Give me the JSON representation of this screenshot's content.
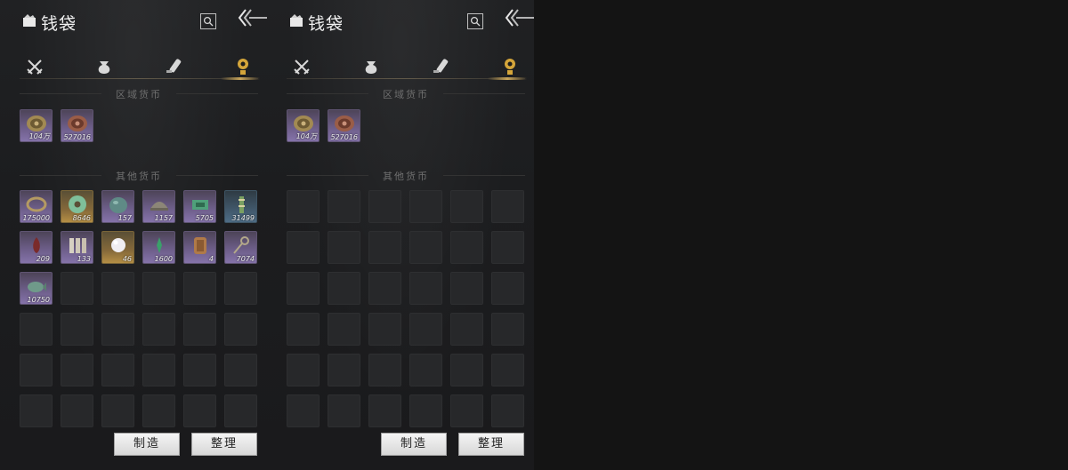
{
  "panels": [
    {
      "title": "钱袋",
      "title_icon": "wallet-icon",
      "search_icon": "search-icon",
      "back_icon": "back-arrow-icon",
      "tabs": [
        {
          "icon": "crossed-swords-icon",
          "active": false
        },
        {
          "icon": "pouch-icon",
          "active": false
        },
        {
          "icon": "scroll-icon",
          "active": false
        },
        {
          "icon": "coin-marker-icon",
          "active": true
        }
      ],
      "regional_header": "区域货币",
      "regional_items": [
        {
          "icon": "gold-disc-coin-icon",
          "count": "104万"
        },
        {
          "icon": "bronze-disc-coin-icon",
          "count": "527016"
        }
      ],
      "other_header": "其他货币",
      "other_items": [
        {
          "icon": "bracelet-icon",
          "count": "175000",
          "rarity": "purple"
        },
        {
          "icon": "jade-ring-icon",
          "count": "8646",
          "rarity": "gold"
        },
        {
          "icon": "green-pebble-icon",
          "count": "157",
          "rarity": "purple"
        },
        {
          "icon": "ingot-icon",
          "count": "1157",
          "rarity": "purple"
        },
        {
          "icon": "green-note-icon",
          "count": "5705",
          "rarity": "purple"
        },
        {
          "icon": "green-token-icon",
          "count": "31499",
          "rarity": "teal"
        },
        {
          "icon": "red-flame-icon",
          "count": "209",
          "rarity": "purple"
        },
        {
          "icon": "bone-slips-icon",
          "count": "133",
          "rarity": "purple"
        },
        {
          "icon": "pearl-icon",
          "count": "46",
          "rarity": "gold"
        },
        {
          "icon": "green-spark-icon",
          "count": "1600",
          "rarity": "purple"
        },
        {
          "icon": "carved-tablet-icon",
          "count": "4",
          "rarity": "purple"
        },
        {
          "icon": "key-icon",
          "count": "7074",
          "rarity": "purple"
        },
        {
          "icon": "jade-carp-icon",
          "count": "10750",
          "rarity": "purple"
        }
      ],
      "buttons": {
        "craft": "制造",
        "sort": "整理"
      }
    },
    {
      "title": "钱袋",
      "title_icon": "wallet-icon",
      "search_icon": "search-icon",
      "back_icon": "back-arrow-icon",
      "tabs": [
        {
          "icon": "crossed-swords-icon",
          "active": false
        },
        {
          "icon": "pouch-icon",
          "active": false
        },
        {
          "icon": "scroll-icon",
          "active": false
        },
        {
          "icon": "coin-marker-icon",
          "active": true
        }
      ],
      "regional_header": "区域货币",
      "regional_items": [
        {
          "icon": "gold-disc-coin-icon",
          "count": "104万"
        },
        {
          "icon": "bronze-disc-coin-icon",
          "count": "527016"
        }
      ],
      "other_header": "其他货币",
      "other_items": [],
      "buttons": {
        "craft": "制造",
        "sort": "整理"
      }
    }
  ],
  "colors": {
    "accent_gold": "#c8a45a",
    "slot_purple": "#6c5d88",
    "background": "#141414"
  }
}
